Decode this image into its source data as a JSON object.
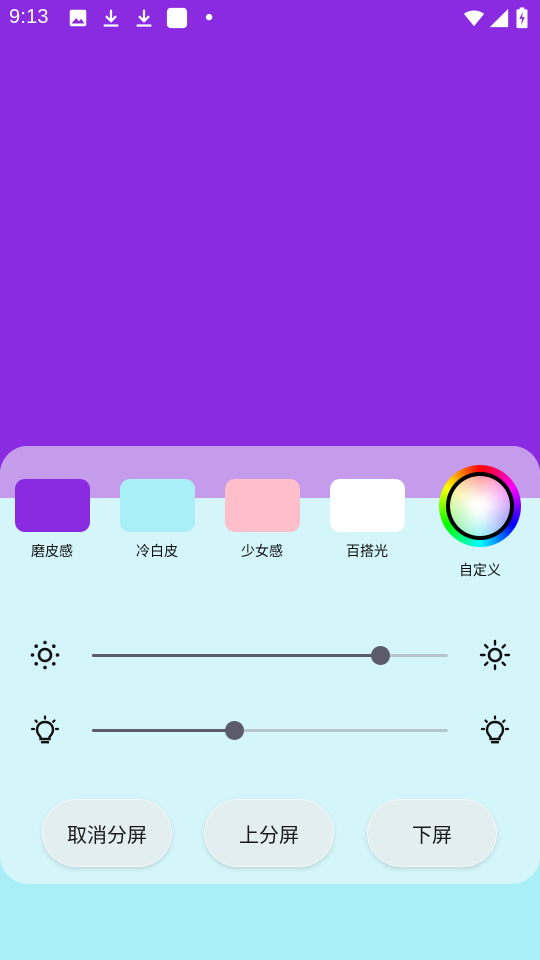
{
  "status_bar": {
    "time": "9:13",
    "left_icons": [
      "image-icon",
      "download-icon",
      "download-icon",
      "app-square-icon",
      "dot-icon"
    ],
    "right_icons": [
      "wifi-icon",
      "signal-icon",
      "battery-charging-icon"
    ]
  },
  "colors": {
    "preview_background": "#8a2be2",
    "panel_band": "#c59ceb",
    "panel_background": "#d4f5f9",
    "page_background": "#a8eff7"
  },
  "presets": [
    {
      "label": "磨皮感",
      "color": "#8a2be2"
    },
    {
      "label": "冷白皮",
      "color": "#a8eff7"
    },
    {
      "label": "少女感",
      "color": "#ffbfca"
    },
    {
      "label": "百搭光",
      "color": "#ffffff"
    }
  ],
  "custom": {
    "label": "自定义",
    "icon": "color-wheel-icon"
  },
  "sliders": [
    {
      "name": "brightness",
      "icon_left": "brightness-low-icon",
      "icon_right": "brightness-high-icon",
      "value": 0.81
    },
    {
      "name": "color-temperature",
      "icon_left": "lightbulb-icon",
      "icon_right": "lightbulb-icon",
      "value": 0.4
    }
  ],
  "buttons": {
    "cancel_split": "取消分屏",
    "upper_split": "上分屏",
    "lower_split": "下屏"
  }
}
